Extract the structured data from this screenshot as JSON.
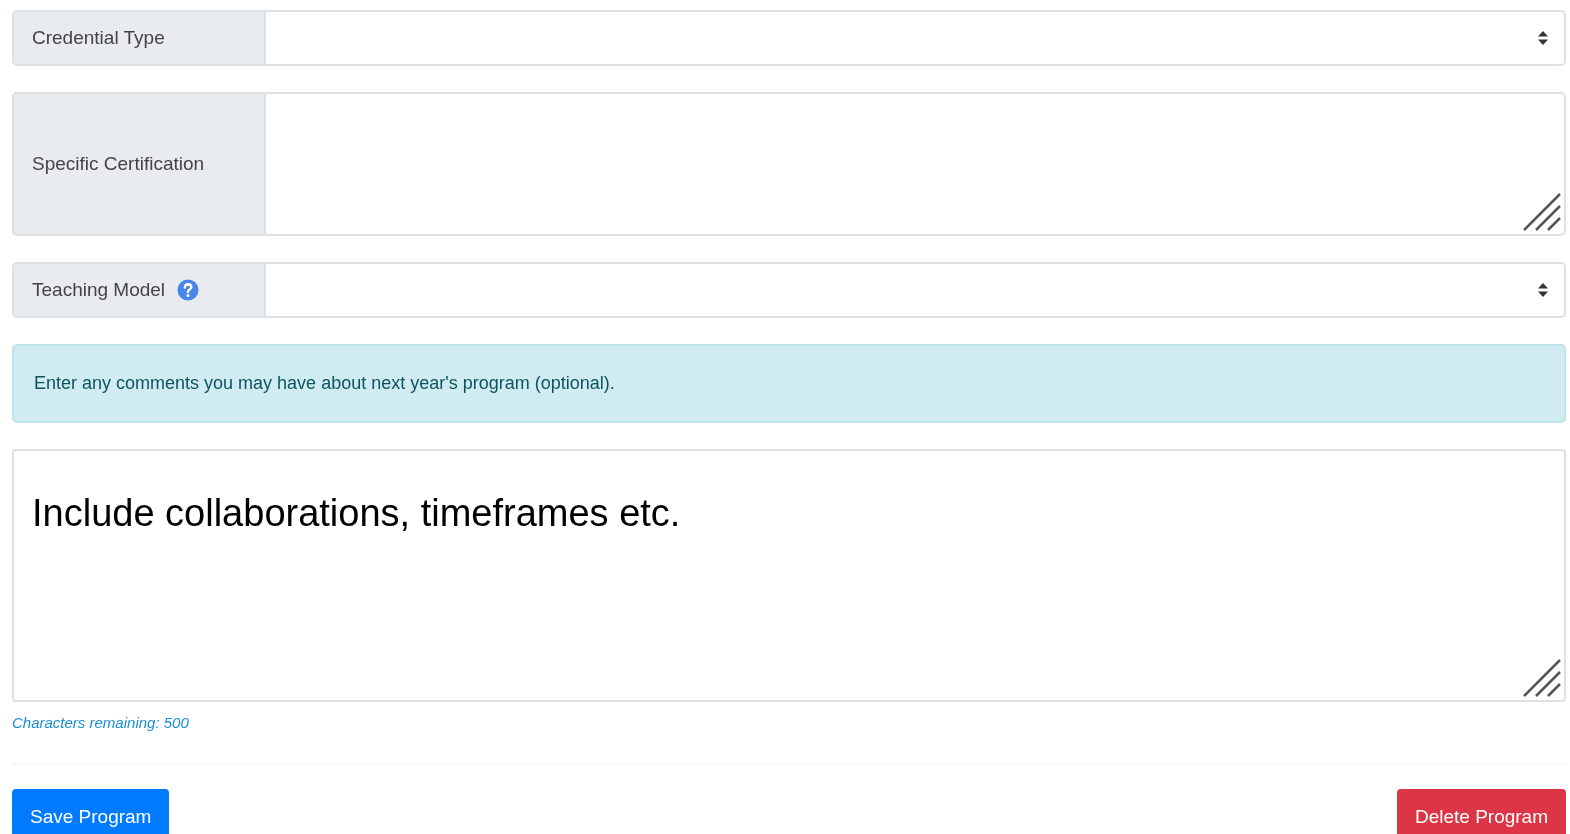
{
  "fields": [
    {
      "kind": "select",
      "label": "Credential Type",
      "help": false
    },
    {
      "kind": "textarea",
      "label": "Specific Certification",
      "help": false
    },
    {
      "kind": "select",
      "label": "Teaching Model",
      "help": true
    }
  ],
  "alert": {
    "text": "Enter any comments you may have about next year's program (optional)."
  },
  "comments": {
    "placeholder": "Include collaborations, timeframes etc.",
    "counter": "Characters remaining: 500"
  },
  "buttons": [
    {
      "label": "Save Program",
      "kind": "primary"
    },
    {
      "label": "Delete Program",
      "kind": "danger"
    }
  ]
}
